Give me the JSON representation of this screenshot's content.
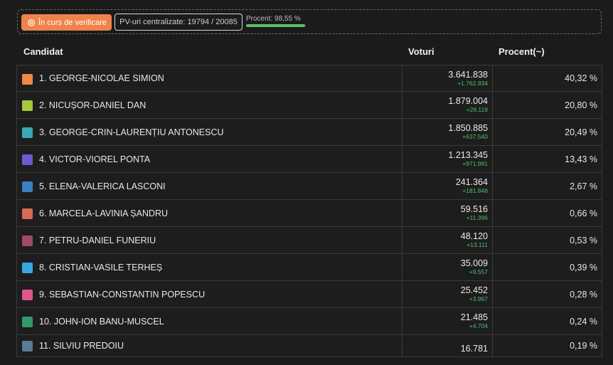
{
  "status": {
    "verificare_label": "În curs de verificare",
    "pv_label": "PV-uri centralizate: 19794 / 20085",
    "procent_label": "Procent: 98,55 %",
    "procent_value": 98.55,
    "progress_color": "#5fbf68",
    "badge_color": "#f0834a"
  },
  "table": {
    "headers": {
      "candidat": "Candidat",
      "voturi": "Voturi",
      "procent": "Procent(~)"
    },
    "rows": [
      {
        "name": "1. GEORGE-NICOLAE SIMION",
        "votes": "3.641.838",
        "delta": "+1.762.834",
        "pct": "40,32 %",
        "color": "#ef8a45"
      },
      {
        "name": "2. NICUȘOR-DANIEL DAN",
        "votes": "1.879.004",
        "delta": "+28.119",
        "pct": "20,80 %",
        "color": "#a7c83a"
      },
      {
        "name": "3. GEORGE-CRIN-LAURENȚIU ANTONESCU",
        "votes": "1.850.885",
        "delta": "+637.540",
        "pct": "20,49 %",
        "color": "#3aa8b3"
      },
      {
        "name": "4. VICTOR-VIOREL PONTA",
        "votes": "1.213.345",
        "delta": "+971.981",
        "pct": "13,43 %",
        "color": "#6a5cd0"
      },
      {
        "name": "5. ELENA-VALERICA LASCONI",
        "votes": "241.364",
        "delta": "+181.848",
        "pct": "2,67 %",
        "color": "#3a7fbf"
      },
      {
        "name": "6. MARCELA-LAVINIA ȘANDRU",
        "votes": "59.516",
        "delta": "+11.396",
        "pct": "0,66 %",
        "color": "#d66a56"
      },
      {
        "name": "7. PETRU-DANIEL FUNERIU",
        "votes": "48.120",
        "delta": "+13.111",
        "pct": "0,53 %",
        "color": "#a04a6a"
      },
      {
        "name": "8. CRISTIAN-VASILE TERHEȘ",
        "votes": "35.009",
        "delta": "+9.557",
        "pct": "0,39 %",
        "color": "#3aa8e0"
      },
      {
        "name": "9. SEBASTIAN-CONSTANTIN POPESCU",
        "votes": "25.452",
        "delta": "+3.967",
        "pct": "0,28 %",
        "color": "#e0558a"
      },
      {
        "name": "10. JOHN-ION BANU-MUSCEL",
        "votes": "21.485",
        "delta": "+4.704",
        "pct": "0,24 %",
        "color": "#2f9a6a"
      },
      {
        "name": "11. SILVIU PREDOIU",
        "votes": "16.781",
        "delta": "",
        "pct": "0,19 %",
        "color": "#5a7a94"
      }
    ]
  }
}
